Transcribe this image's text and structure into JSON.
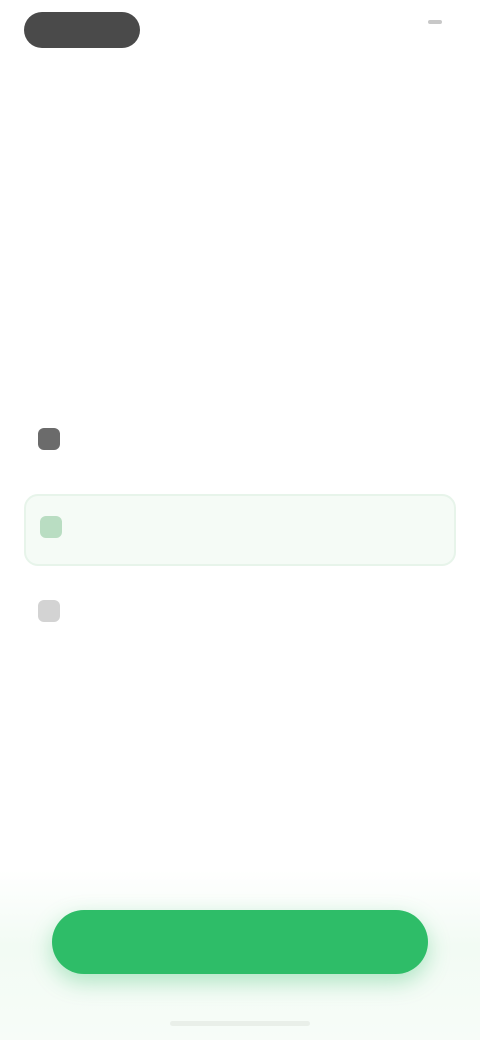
{
  "status_bar": {
    "time": "",
    "right_text": ""
  },
  "title": "",
  "options": [
    {
      "title": "",
      "subtitle": "",
      "icon": "option-icon",
      "selected": false
    },
    {
      "title": "",
      "subtitle": "",
      "icon": "option-icon",
      "selected": true
    },
    {
      "title": "",
      "subtitle": "",
      "icon": "option-icon",
      "selected": false
    }
  ],
  "primary_button": {
    "label": ""
  },
  "colors": {
    "accent": "#2ebd68",
    "selected_bg": "#f5fbf6"
  }
}
